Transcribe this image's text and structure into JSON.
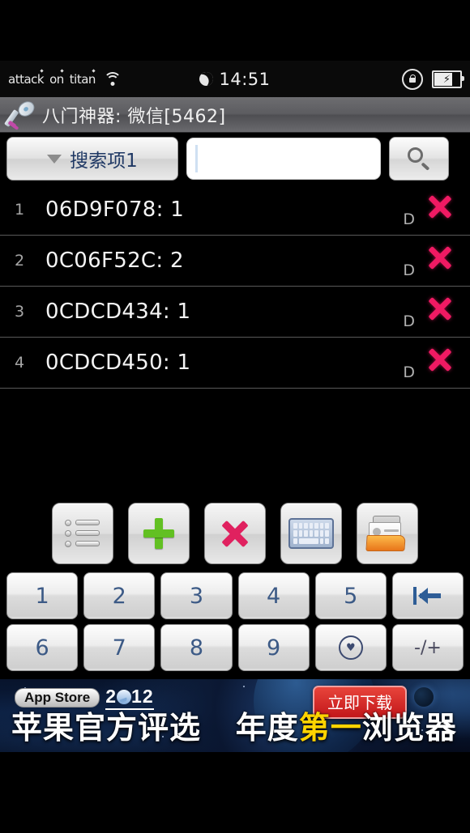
{
  "statusbar": {
    "words": [
      "attack",
      "on",
      "titan"
    ],
    "wifi_icon": "wifi-icon",
    "moon_icon": "crescent-moon-icon",
    "clock": "14:51",
    "rotation_lock_icon": "rotation-lock-icon",
    "battery_icon": "battery-charging-icon",
    "battery_bolt": "⚡"
  },
  "titlebar": {
    "icon": "key-icon",
    "title": "八门神器: 微信[5462]"
  },
  "search": {
    "dropdown_label": "搜索项1",
    "dropdown_caret": "chevron-down-icon",
    "input_value": "",
    "input_placeholder": "",
    "search_icon": "magnifier-icon"
  },
  "list": {
    "rows": [
      {
        "index": "1",
        "text": "06D9F078: 1",
        "flag": "D",
        "delete_icon": "close-x-icon"
      },
      {
        "index": "2",
        "text": "0C06F52C: 2",
        "flag": "D",
        "delete_icon": "close-x-icon"
      },
      {
        "index": "3",
        "text": "0CDCD434: 1",
        "flag": "D",
        "delete_icon": "close-x-icon"
      },
      {
        "index": "4",
        "text": "0CDCD450: 1",
        "flag": "D",
        "delete_icon": "close-x-icon"
      }
    ]
  },
  "toolbar": {
    "buttons": [
      {
        "name": "list-view-button",
        "icon": "list-icon"
      },
      {
        "name": "add-button",
        "icon": "plus-icon"
      },
      {
        "name": "delete-all-button",
        "icon": "cross-icon"
      },
      {
        "name": "keyboard-button",
        "icon": "keyboard-icon"
      },
      {
        "name": "open-folder-button",
        "icon": "folder-contact-icon"
      }
    ]
  },
  "keypad": {
    "row1": [
      {
        "label": "1",
        "kind": "digit"
      },
      {
        "label": "2",
        "kind": "digit"
      },
      {
        "label": "3",
        "kind": "digit"
      },
      {
        "label": "4",
        "kind": "digit"
      },
      {
        "label": "5",
        "kind": "digit"
      },
      {
        "label": "",
        "kind": "backspace",
        "icon": "backspace-arrow-icon"
      }
    ],
    "row2": [
      {
        "label": "6",
        "kind": "digit"
      },
      {
        "label": "7",
        "kind": "digit"
      },
      {
        "label": "8",
        "kind": "digit"
      },
      {
        "label": "9",
        "kind": "digit"
      },
      {
        "label": "",
        "kind": "zero-heart",
        "icon": "circled-heart-icon",
        "glyph": "♥"
      },
      {
        "label": "-/+",
        "kind": "sign"
      }
    ]
  },
  "ad": {
    "badge": "App Store",
    "year_pre": "2",
    "year_post": "12",
    "download_label": "立即下载",
    "headline_1": "苹果官方评选",
    "headline_hl": "第一",
    "headline_2": "年度",
    "headline_3": "浏览器"
  },
  "colors": {
    "accent_pink": "#f01a63",
    "accent_green": "#62c022",
    "key_text_blue": "#3c5a86",
    "dropdown_text": "#1f3864",
    "ad_highlight": "#ffd400",
    "ad_button_red": "#c3171a"
  }
}
